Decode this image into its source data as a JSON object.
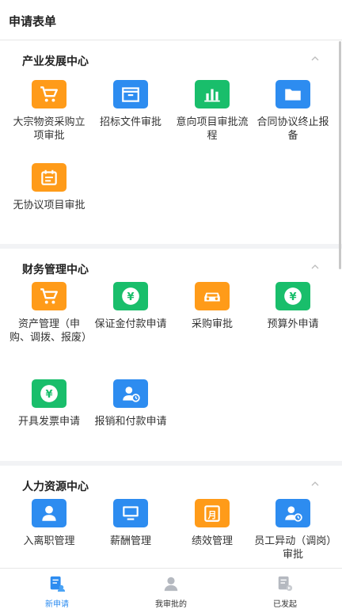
{
  "header": {
    "title": "申请表单"
  },
  "sections": [
    {
      "title": "产业发展中心",
      "items": [
        {
          "label": "大宗物资采购立项审批",
          "icon": "cart-icon"
        },
        {
          "label": "招标文件审批",
          "icon": "archive-icon"
        },
        {
          "label": "意向项目审批流程",
          "icon": "bar-chart-icon"
        },
        {
          "label": "合同协议终止报备",
          "icon": "folder-icon"
        },
        {
          "label": "无协议项目审批",
          "icon": "calendar-icon"
        }
      ]
    },
    {
      "title": "财务管理中心",
      "items": [
        {
          "label": "资产管理（申购、调拨、报废）",
          "icon": "cart-icon"
        },
        {
          "label": "保证金付款申请",
          "icon": "yen-icon"
        },
        {
          "label": "采购审批",
          "icon": "car-icon"
        },
        {
          "label": "预算外申请",
          "icon": "yen-icon"
        },
        {
          "label": "开具发票申请",
          "icon": "yen-icon"
        },
        {
          "label": "报销和付款申请",
          "icon": "user-clock-icon"
        }
      ]
    },
    {
      "title": "人力资源中心",
      "items": [
        {
          "label": "入离职管理",
          "icon": "user-icon"
        },
        {
          "label": "薪酬管理",
          "icon": "monitor-icon"
        },
        {
          "label": "绩效管理",
          "icon": "calendar-month-icon"
        },
        {
          "label": "员工异动（调岗）审批",
          "icon": "user-clock-icon"
        }
      ]
    }
  ],
  "tabs": [
    {
      "label": "新申请",
      "active": true
    },
    {
      "label": "我审批的",
      "active": false
    },
    {
      "label": "已发起",
      "active": false
    }
  ],
  "icon_glyph_month": "月",
  "colors": {
    "orange": "#ff9b19",
    "blue": "#2d8cf0",
    "green": "#19be6b"
  }
}
